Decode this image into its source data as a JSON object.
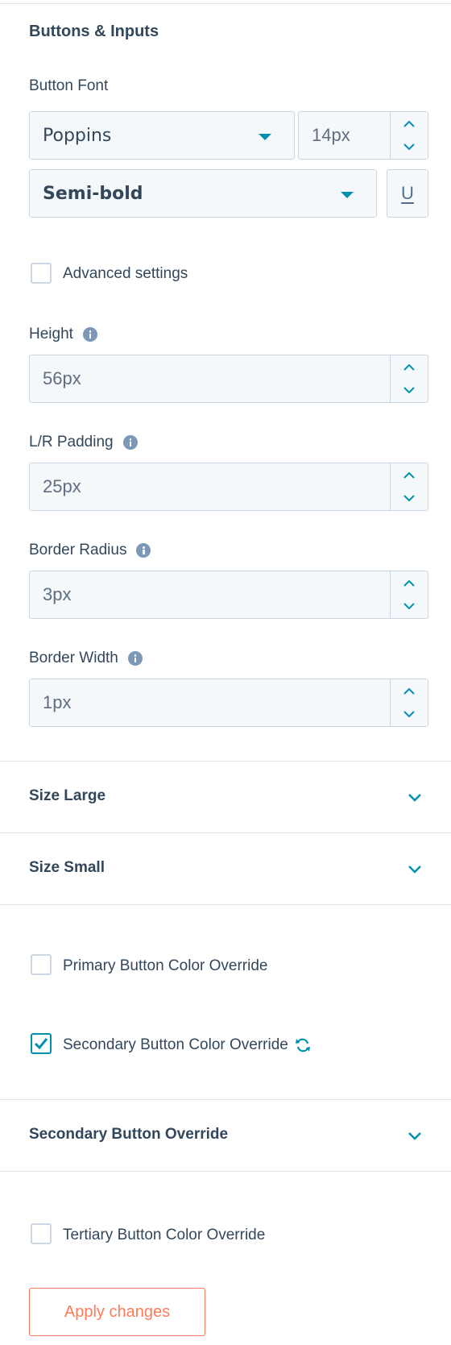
{
  "section": {
    "title": "Buttons & Inputs"
  },
  "button_font": {
    "label": "Button Font",
    "family": "Poppins",
    "size": "14px",
    "weight": "Semi-bold",
    "underline_glyph": "U"
  },
  "advanced": {
    "label": "Advanced settings",
    "checked": false
  },
  "fields": [
    {
      "label": "Height",
      "value": "56px",
      "info": true
    },
    {
      "label": "L/R Padding",
      "value": "25px",
      "info": true
    },
    {
      "label": "Border Radius",
      "value": "3px",
      "info": true
    },
    {
      "label": "Border Width",
      "value": "1px",
      "info": true
    }
  ],
  "accordions": {
    "size_large": "Size Large",
    "size_small": "Size Small",
    "secondary_override": "Secondary Button Override"
  },
  "overrides": {
    "primary": {
      "label": "Primary Button Color Override",
      "checked": false
    },
    "secondary": {
      "label": "Secondary Button Color Override",
      "checked": true
    },
    "tertiary": {
      "label": "Tertiary Button Color Override",
      "checked": false
    }
  },
  "apply_button": {
    "label": "Apply changes"
  },
  "icons": {
    "info": "info-icon",
    "chevron_up": "chevron-up-icon",
    "chevron_down": "chevron-down-icon",
    "caret_down": "caret-down-icon",
    "underline": "underline-icon",
    "reset": "reset-icon",
    "check": "checkmark-icon"
  },
  "colors": {
    "accent": "#0091ae",
    "text": "#33475b",
    "border": "#cbd6e2",
    "field_bg": "#f5f8fa",
    "apply": "#ff7a59",
    "info_icon": "#7c98b6"
  }
}
